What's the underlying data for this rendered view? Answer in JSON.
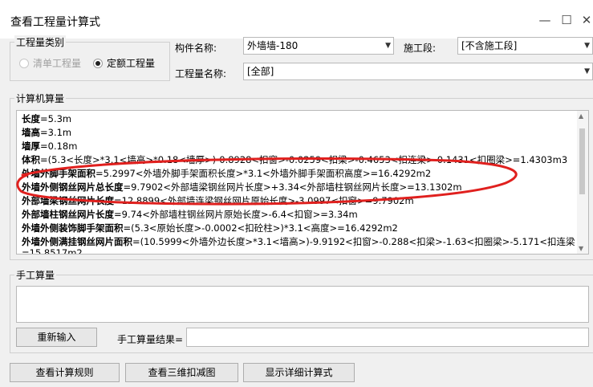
{
  "window": {
    "title": "查看工程量计算式",
    "min": "—",
    "max": "☐",
    "close": "✕"
  },
  "category": {
    "label": "工程量类别",
    "options": [
      {
        "label": "清单工程量",
        "selected": false,
        "disabled": true
      },
      {
        "label": "定额工程量",
        "selected": true,
        "disabled": false
      }
    ]
  },
  "component": {
    "label": "构件名称:",
    "value": "外墙墙-180"
  },
  "section": {
    "label": "施工段:",
    "value": "[不含施工段]"
  },
  "quantity_name": {
    "label": "工程量名称:",
    "value": "[全部]"
  },
  "calc": {
    "label": "计算机算量",
    "lines": [
      {
        "name": "长度",
        "expr": "=5.3m"
      },
      {
        "name": "墙高",
        "expr": "=3.1m"
      },
      {
        "name": "墙厚",
        "expr": "=0.18m"
      },
      {
        "name": "体积",
        "expr": "=(5.3<长度>*3.1<墙高>*0.18<墙厚>)-0.8928<扣窗>-0.0259<扣梁>-0.4653<扣连梁>-0.1431<扣圈梁>=1.4303m3"
      },
      {
        "name": "外墙外脚手架面积",
        "expr": "=5.2997<外墙外脚手架面积长度>*3.1<外墙外脚手架面积高度>=16.4292m2"
      },
      {
        "name": "外墙外侧钢丝网片总长度",
        "expr": "=9.7902<外部墙梁钢丝网片长度>+3.34<外部墙柱钢丝网片长度>=13.1302m"
      },
      {
        "name": "外部墙梁钢丝网片长度",
        "expr": "=12.8899<外部墙连梁钢丝网片原始长度>-3.0997<扣窗>=9.7902m"
      },
      {
        "name": "外部墙柱钢丝网片长度",
        "expr": "=9.74<外部墙柱钢丝网片原始长度>-6.4<扣窗>=3.34m"
      },
      {
        "name": "外墙外侧装饰脚手架面积",
        "expr": "=(5.3<原始长度>-0.0002<扣砼柱>)*3.1<高度>=16.4292m2"
      },
      {
        "name": "外墙外侧满挂钢丝网片面积",
        "expr": "=(10.5999<外墙外边长度>*3.1<墙高>)-9.9192<扣窗>-0.288<扣梁>-1.63<扣圈梁>-5.171<扣连梁"
      },
      {
        "name": "",
        "expr": "=15.8517m2"
      }
    ]
  },
  "manual": {
    "label": "手工算量",
    "reenter_button": "重新输入",
    "result_label": "手工算量结果=",
    "result_value": ""
  },
  "buttons": {
    "view_rules": "查看计算规则",
    "view_3d": "查看三维扣减图",
    "show_detail": "显示详细计算式"
  },
  "colors": {
    "annotation": "#e0201e",
    "selected_radio": "#222222"
  }
}
